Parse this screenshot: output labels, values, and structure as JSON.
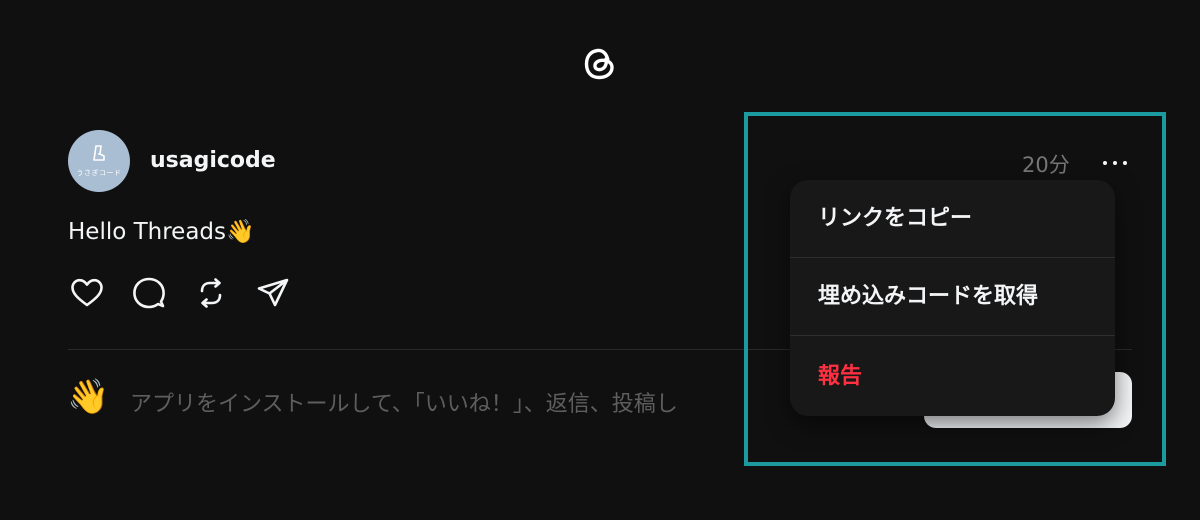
{
  "app": {
    "logo_icon": "threads-logo-icon"
  },
  "post": {
    "avatar_caption": "うさぎコード",
    "username": "usagicode",
    "timestamp": "20分",
    "text": "Hello Threads👋",
    "actions": [
      "heart-icon",
      "comment-icon",
      "repost-icon",
      "share-icon"
    ]
  },
  "menu": {
    "items": [
      {
        "label": "リンクをコピー"
      },
      {
        "label": "埋め込みコードを取得"
      },
      {
        "label": "報告"
      }
    ]
  },
  "cta": {
    "emoji": "👋",
    "text": "アプリをインストールして、「いいね！」、返信、投稿し"
  },
  "colors": {
    "background": "#101010",
    "text": "#f3f5f7",
    "muted": "#777777",
    "danger": "#ff3040",
    "highlight": "#1b9aa0",
    "menu_bg": "#181818"
  }
}
